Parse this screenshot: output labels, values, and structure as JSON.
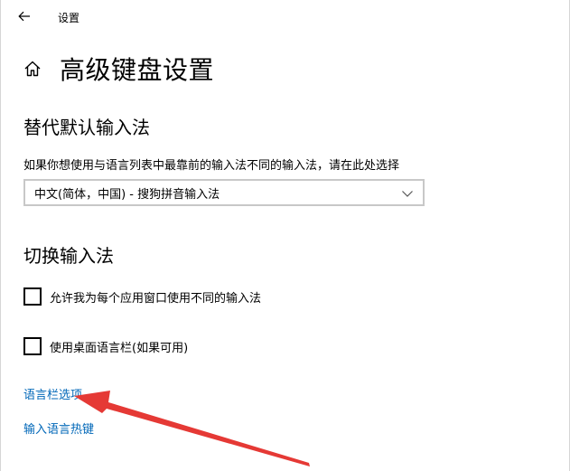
{
  "window": {
    "title": "设置",
    "back_icon": "back-arrow-icon"
  },
  "page": {
    "home_icon": "home-icon",
    "title": "高级键盘设置"
  },
  "override": {
    "heading": "替代默认输入法",
    "description": "如果你想使用与语言列表中最靠前的输入法不同的输入法，请在此处选择",
    "selected": "中文(简体，中国) - 搜狗拼音输入法"
  },
  "switching": {
    "heading": "切换输入法",
    "options": [
      {
        "label": "允许我为每个应用窗口使用不同的输入法",
        "checked": false
      },
      {
        "label": "使用桌面语言栏(如果可用)",
        "checked": false
      }
    ]
  },
  "links": {
    "language_bar_options": "语言栏选项",
    "input_language_hotkeys": "输入语言热键"
  },
  "annotation": {
    "arrow_color": "#e53935"
  },
  "colors": {
    "link": "#0067b8",
    "accent_arrow": "#e53935"
  }
}
